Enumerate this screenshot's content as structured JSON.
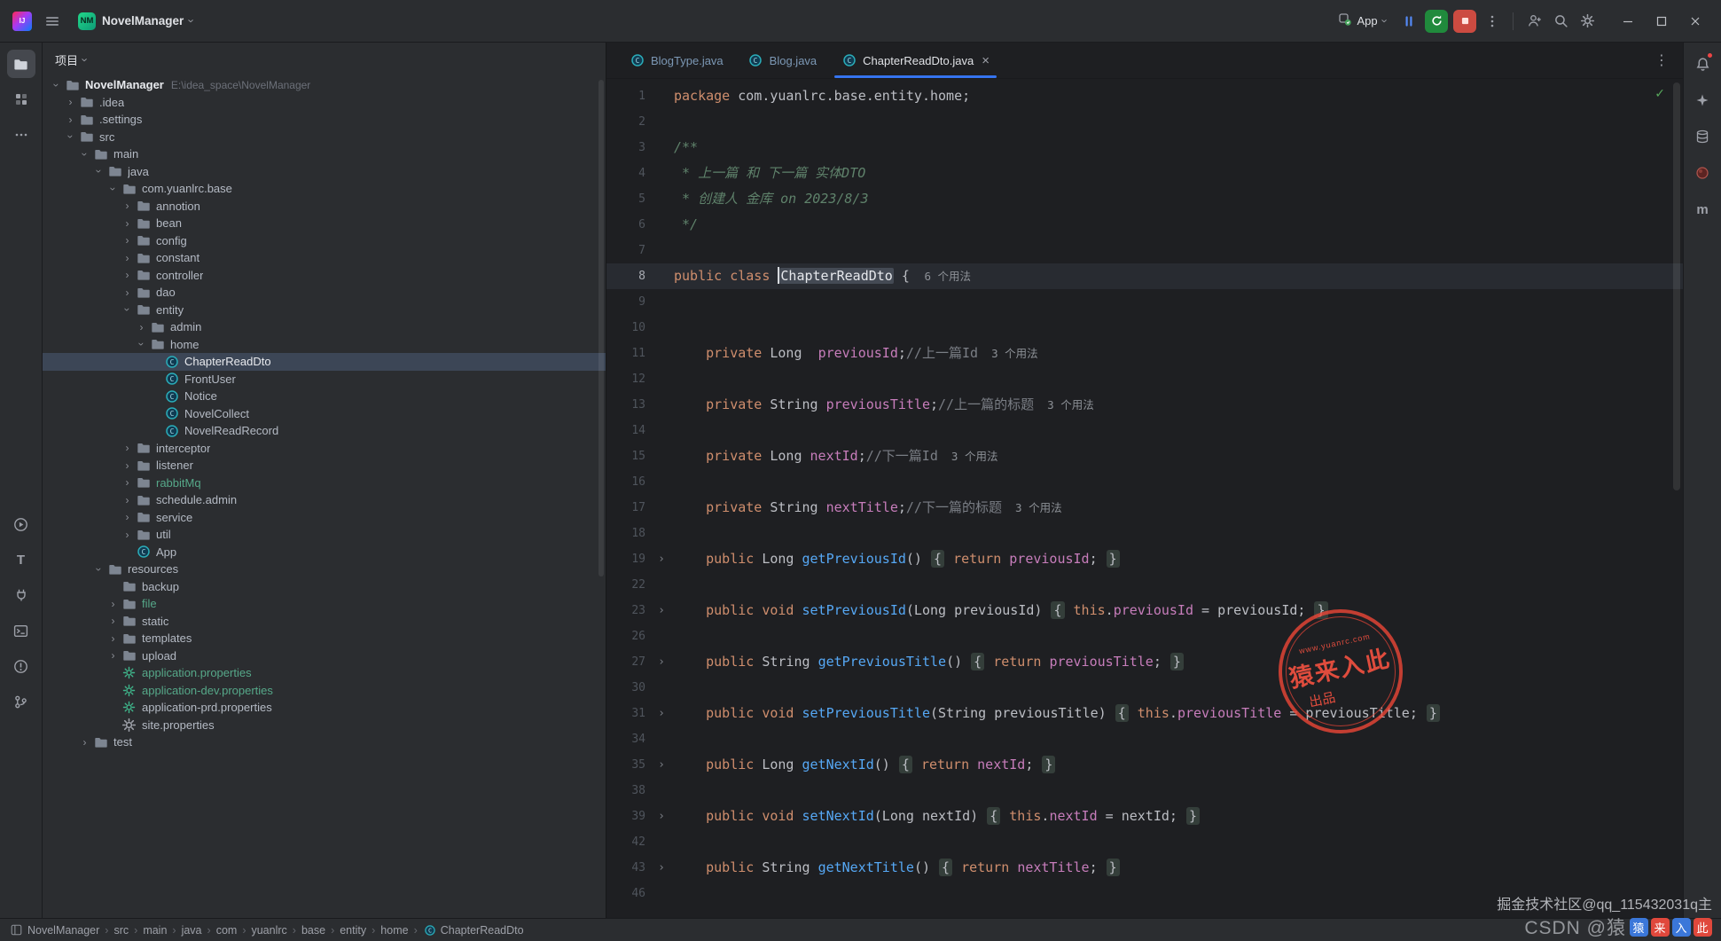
{
  "titlebar": {
    "project_badge": "NM",
    "project_name": "NovelManager",
    "run_config": "App",
    "actions": [
      {
        "name": "pause-button",
        "icon": "pause"
      },
      {
        "name": "rerun-button",
        "icon": "rerun"
      },
      {
        "name": "stop-button",
        "icon": "stop"
      },
      {
        "name": "more-actions-icon",
        "icon": "kebab"
      },
      {
        "divider": true
      },
      {
        "name": "code-with-me-icon",
        "icon": "person"
      },
      {
        "name": "search-everywhere-icon",
        "icon": "search"
      },
      {
        "name": "settings-icon",
        "icon": "gear"
      }
    ]
  },
  "left_strip": {
    "top": [
      {
        "name": "project-tool-icon",
        "icon": "folder-light",
        "active": true
      },
      {
        "name": "structure-tool-icon",
        "icon": "structure"
      },
      {
        "name": "more-tool-windows-icon",
        "icon": "more"
      }
    ],
    "bottom": [
      {
        "name": "services-tool-icon",
        "icon": "play-circle"
      },
      {
        "name": "translation-tool-icon",
        "icon": "",
        "label": "T"
      },
      {
        "name": "endpoints-tool-icon",
        "icon": "plug"
      },
      {
        "name": "terminal-tool-icon",
        "icon": "terminal"
      },
      {
        "name": "problems-tool-icon",
        "icon": "problems"
      },
      {
        "name": "version-control-tool-icon",
        "icon": "git"
      }
    ]
  },
  "right_strip": [
    {
      "name": "notifications-icon",
      "icon": "bell",
      "badge": true
    },
    {
      "name": "ai-assistant-icon",
      "icon": "sparkle"
    },
    {
      "name": "database-tool-icon",
      "icon": "database"
    },
    {
      "name": "profiler-tool-icon",
      "icon": "profiler"
    },
    {
      "name": "maven-tool-icon",
      "icon": "",
      "label": "m"
    }
  ],
  "project_panel": {
    "title": "项目",
    "tree": [
      {
        "l": "NovelManager",
        "d": 0,
        "i": "folder",
        "c": "open",
        "b": 1,
        "sub": "E:\\idea_space\\NovelManager"
      },
      {
        "l": ".idea",
        "d": 1,
        "i": "folder",
        "c": "closed"
      },
      {
        "l": ".settings",
        "d": 1,
        "i": "folder",
        "c": "closed"
      },
      {
        "l": "src",
        "d": 1,
        "i": "folder",
        "c": "open"
      },
      {
        "l": "main",
        "d": 2,
        "i": "folder",
        "c": "open"
      },
      {
        "l": "java",
        "d": 3,
        "i": "folder",
        "c": "open"
      },
      {
        "l": "com.yuanlrc.base",
        "d": 4,
        "i": "folder",
        "c": "open"
      },
      {
        "l": "annotion",
        "d": 5,
        "i": "folder",
        "c": "closed"
      },
      {
        "l": "bean",
        "d": 5,
        "i": "folder",
        "c": "closed"
      },
      {
        "l": "config",
        "d": 5,
        "i": "folder",
        "c": "closed"
      },
      {
        "l": "constant",
        "d": 5,
        "i": "folder",
        "c": "closed"
      },
      {
        "l": "controller",
        "d": 5,
        "i": "folder",
        "c": "closed"
      },
      {
        "l": "dao",
        "d": 5,
        "i": "folder",
        "c": "closed"
      },
      {
        "l": "entity",
        "d": 5,
        "i": "folder",
        "c": "open"
      },
      {
        "l": "admin",
        "d": 6,
        "i": "folder",
        "c": "closed"
      },
      {
        "l": "home",
        "d": 6,
        "i": "folder",
        "c": "open"
      },
      {
        "l": "ChapterReadDto",
        "d": 7,
        "i": "class",
        "sel": 1
      },
      {
        "l": "FrontUser",
        "d": 7,
        "i": "class"
      },
      {
        "l": "Notice",
        "d": 7,
        "i": "class"
      },
      {
        "l": "NovelCollect",
        "d": 7,
        "i": "class"
      },
      {
        "l": "NovelReadRecord",
        "d": 7,
        "i": "class"
      },
      {
        "l": "interceptor",
        "d": 5,
        "i": "folder",
        "c": "closed"
      },
      {
        "l": "listener",
        "d": 5,
        "i": "folder",
        "c": "closed"
      },
      {
        "l": "rabbitMq",
        "d": 5,
        "i": "folder",
        "c": "closed",
        "col": "#56a889"
      },
      {
        "l": "schedule.admin",
        "d": 5,
        "i": "folder",
        "c": "closed"
      },
      {
        "l": "service",
        "d": 5,
        "i": "folder",
        "c": "closed"
      },
      {
        "l": "util",
        "d": 5,
        "i": "folder",
        "c": "closed"
      },
      {
        "l": "App",
        "d": 5,
        "i": "class"
      },
      {
        "l": "resources",
        "d": 3,
        "i": "folder",
        "c": "open"
      },
      {
        "l": "backup",
        "d": 4,
        "i": "folder"
      },
      {
        "l": "file",
        "d": 4,
        "i": "folder",
        "c": "closed",
        "col": "#56a889"
      },
      {
        "l": "static",
        "d": 4,
        "i": "folder",
        "c": "closed"
      },
      {
        "l": "templates",
        "d": 4,
        "i": "folder",
        "c": "closed"
      },
      {
        "l": "upload",
        "d": 4,
        "i": "folder",
        "c": "closed"
      },
      {
        "l": "application.properties",
        "d": 4,
        "i": "gear-teal",
        "col": "#56a889"
      },
      {
        "l": "application-dev.properties",
        "d": 4,
        "i": "gear-teal",
        "col": "#56a889"
      },
      {
        "l": "application-prd.properties",
        "d": 4,
        "i": "gear-teal"
      },
      {
        "l": "site.properties",
        "d": 4,
        "i": "gear"
      },
      {
        "l": "test",
        "d": 2,
        "i": "folder",
        "c": "closed"
      }
    ]
  },
  "editor": {
    "tabs": [
      {
        "label": "BlogType.java",
        "color": "#7c98b5"
      },
      {
        "label": "Blog.java",
        "color": "#7c98b5"
      },
      {
        "label": "ChapterReadDto.java",
        "active": true
      }
    ],
    "lines": [
      {
        "n": "1",
        "tk": [
          {
            "t": "package",
            "c": "kw"
          },
          {
            "t": " com.yuanlrc.base.entity.home;",
            "c": "pl"
          }
        ]
      },
      {
        "n": "2",
        "tk": []
      },
      {
        "n": "3",
        "tk": [
          {
            "t": "/**",
            "c": "doc"
          }
        ]
      },
      {
        "n": "4",
        "tk": [
          {
            "t": " * 上一篇 和 下一篇 实体DTO",
            "c": "doc"
          }
        ]
      },
      {
        "n": "5",
        "tk": [
          {
            "t": " * 创建人 金库 on 2023/8/3",
            "c": "doc"
          }
        ]
      },
      {
        "n": "6",
        "tk": [
          {
            "t": " */",
            "c": "doc"
          }
        ]
      },
      {
        "n": "7",
        "tk": []
      },
      {
        "n": "8",
        "cur": 1,
        "tk": [
          {
            "t": "public class ",
            "c": "kw"
          },
          {
            "t": "",
            "c": "caret"
          },
          {
            "t": "ChapterReadDto",
            "c": "cls"
          },
          {
            "t": " { ",
            "c": "pl"
          },
          {
            "t": " 6 个用法",
            "c": "hint"
          }
        ]
      },
      {
        "n": "9",
        "tk": []
      },
      {
        "n": "10",
        "tk": []
      },
      {
        "n": "11",
        "tk": [
          {
            "t": "    ",
            "c": "pl"
          },
          {
            "t": "private",
            "c": "kw"
          },
          {
            "t": " Long  ",
            "c": "pl"
          },
          {
            "t": "previousId",
            "c": "fld"
          },
          {
            "t": ";",
            "c": "pl"
          },
          {
            "t": "//上一篇Id",
            "c": "cmt"
          },
          {
            "t": "  3 个用法",
            "c": "hint"
          }
        ]
      },
      {
        "n": "12",
        "tk": []
      },
      {
        "n": "13",
        "tk": [
          {
            "t": "    ",
            "c": "pl"
          },
          {
            "t": "private",
            "c": "kw"
          },
          {
            "t": " String ",
            "c": "pl"
          },
          {
            "t": "previousTitle",
            "c": "fld"
          },
          {
            "t": ";",
            "c": "pl"
          },
          {
            "t": "//上一篇的标题",
            "c": "cmt"
          },
          {
            "t": "  3 个用法",
            "c": "hint"
          }
        ]
      },
      {
        "n": "14",
        "tk": []
      },
      {
        "n": "15",
        "tk": [
          {
            "t": "    ",
            "c": "pl"
          },
          {
            "t": "private",
            "c": "kw"
          },
          {
            "t": " Long ",
            "c": "pl"
          },
          {
            "t": "nextId",
            "c": "fld"
          },
          {
            "t": ";",
            "c": "pl"
          },
          {
            "t": "//下一篇Id",
            "c": "cmt"
          },
          {
            "t": "  3 个用法",
            "c": "hint"
          }
        ]
      },
      {
        "n": "16",
        "tk": []
      },
      {
        "n": "17",
        "tk": [
          {
            "t": "    ",
            "c": "pl"
          },
          {
            "t": "private",
            "c": "kw"
          },
          {
            "t": " String ",
            "c": "pl"
          },
          {
            "t": "nextTitle",
            "c": "fld"
          },
          {
            "t": ";",
            "c": "pl"
          },
          {
            "t": "//下一篇的标题",
            "c": "cmt"
          },
          {
            "t": "  3 个用法",
            "c": "hint"
          }
        ]
      },
      {
        "n": "18",
        "tk": []
      },
      {
        "n": "19",
        "fold": 1,
        "tk": [
          {
            "t": "    ",
            "c": "pl"
          },
          {
            "t": "public",
            "c": "kw"
          },
          {
            "t": " Long ",
            "c": "pl"
          },
          {
            "t": "getPreviousId",
            "c": "mth"
          },
          {
            "t": "() ",
            "c": "pl"
          },
          {
            "t": "{",
            "c": "fb"
          },
          {
            "t": " ",
            "c": "pl"
          },
          {
            "t": "return",
            "c": "kw"
          },
          {
            "t": " ",
            "c": "pl"
          },
          {
            "t": "previousId",
            "c": "fld"
          },
          {
            "t": "; ",
            "c": "pl"
          },
          {
            "t": "}",
            "c": "fb"
          }
        ]
      },
      {
        "n": "22",
        "tk": []
      },
      {
        "n": "23",
        "fold": 1,
        "tk": [
          {
            "t": "    ",
            "c": "pl"
          },
          {
            "t": "public void ",
            "c": "kw"
          },
          {
            "t": "setPreviousId",
            "c": "mth"
          },
          {
            "t": "(Long previousId) ",
            "c": "pl"
          },
          {
            "t": "{",
            "c": "fb"
          },
          {
            "t": " ",
            "c": "pl"
          },
          {
            "t": "this",
            "c": "kw"
          },
          {
            "t": ".",
            "c": "pl"
          },
          {
            "t": "previousId",
            "c": "fld"
          },
          {
            "t": " = previousId; ",
            "c": "pl"
          },
          {
            "t": "}",
            "c": "fb"
          }
        ]
      },
      {
        "n": "26",
        "tk": []
      },
      {
        "n": "27",
        "fold": 1,
        "tk": [
          {
            "t": "    ",
            "c": "pl"
          },
          {
            "t": "public",
            "c": "kw"
          },
          {
            "t": " String ",
            "c": "pl"
          },
          {
            "t": "getPreviousTitle",
            "c": "mth"
          },
          {
            "t": "() ",
            "c": "pl"
          },
          {
            "t": "{",
            "c": "fb"
          },
          {
            "t": " ",
            "c": "pl"
          },
          {
            "t": "return",
            "c": "kw"
          },
          {
            "t": " ",
            "c": "pl"
          },
          {
            "t": "previousTitle",
            "c": "fld"
          },
          {
            "t": "; ",
            "c": "pl"
          },
          {
            "t": "}",
            "c": "fb"
          }
        ]
      },
      {
        "n": "30",
        "tk": []
      },
      {
        "n": "31",
        "fold": 1,
        "tk": [
          {
            "t": "    ",
            "c": "pl"
          },
          {
            "t": "public void ",
            "c": "kw"
          },
          {
            "t": "setPreviousTitle",
            "c": "mth"
          },
          {
            "t": "(String previousTitle) ",
            "c": "pl"
          },
          {
            "t": "{",
            "c": "fb"
          },
          {
            "t": " ",
            "c": "pl"
          },
          {
            "t": "this",
            "c": "kw"
          },
          {
            "t": ".",
            "c": "pl"
          },
          {
            "t": "previousTitle",
            "c": "fld"
          },
          {
            "t": " = previousTitle; ",
            "c": "pl"
          },
          {
            "t": "}",
            "c": "fb"
          }
        ]
      },
      {
        "n": "34",
        "tk": []
      },
      {
        "n": "35",
        "fold": 1,
        "tk": [
          {
            "t": "    ",
            "c": "pl"
          },
          {
            "t": "public",
            "c": "kw"
          },
          {
            "t": " Long ",
            "c": "pl"
          },
          {
            "t": "getNextId",
            "c": "mth"
          },
          {
            "t": "() ",
            "c": "pl"
          },
          {
            "t": "{",
            "c": "fb"
          },
          {
            "t": " ",
            "c": "pl"
          },
          {
            "t": "return",
            "c": "kw"
          },
          {
            "t": " ",
            "c": "pl"
          },
          {
            "t": "nextId",
            "c": "fld"
          },
          {
            "t": "; ",
            "c": "pl"
          },
          {
            "t": "}",
            "c": "fb"
          }
        ]
      },
      {
        "n": "38",
        "tk": []
      },
      {
        "n": "39",
        "fold": 1,
        "tk": [
          {
            "t": "    ",
            "c": "pl"
          },
          {
            "t": "public void ",
            "c": "kw"
          },
          {
            "t": "setNextId",
            "c": "mth"
          },
          {
            "t": "(Long nextId) ",
            "c": "pl"
          },
          {
            "t": "{",
            "c": "fb"
          },
          {
            "t": " ",
            "c": "pl"
          },
          {
            "t": "this",
            "c": "kw"
          },
          {
            "t": ".",
            "c": "pl"
          },
          {
            "t": "nextId",
            "c": "fld"
          },
          {
            "t": " = nextId; ",
            "c": "pl"
          },
          {
            "t": "}",
            "c": "fb"
          }
        ]
      },
      {
        "n": "42",
        "tk": []
      },
      {
        "n": "43",
        "fold": 1,
        "tk": [
          {
            "t": "    ",
            "c": "pl"
          },
          {
            "t": "public",
            "c": "kw"
          },
          {
            "t": " String ",
            "c": "pl"
          },
          {
            "t": "getNextTitle",
            "c": "mth"
          },
          {
            "t": "() ",
            "c": "p l"
          },
          {
            "t": "{",
            "c": "fb"
          },
          {
            "t": " ",
            "c": "pl"
          },
          {
            "t": "return",
            "c": "kw"
          },
          {
            "t": " ",
            "c": "pl"
          },
          {
            "t": "nextTitle",
            "c": "fld"
          },
          {
            "t": "; ",
            "c": "pl"
          },
          {
            "t": "}",
            "c": "fb"
          }
        ]
      },
      {
        "n": "46",
        "tk": []
      }
    ]
  },
  "statusbar": {
    "crumbs": [
      "NovelManager",
      "src",
      "main",
      "java",
      "com",
      "yuanlrc",
      "base",
      "entity",
      "home",
      "ChapterReadDto"
    ]
  },
  "watermarks": {
    "stamp": {
      "top": "www.yuanrc.com",
      "main": "猿来入此",
      "sub": "出品"
    },
    "juejin": "掘金技术社区@qq_115432031q主",
    "csdn": "CSDN @猿",
    "badges": [
      "猿",
      "来",
      "入",
      "此"
    ]
  },
  "colors": {
    "accent": "#3574f0",
    "run_green": "#208a3c",
    "stop_red": "#cc4b41",
    "selection": "#3c4656"
  }
}
